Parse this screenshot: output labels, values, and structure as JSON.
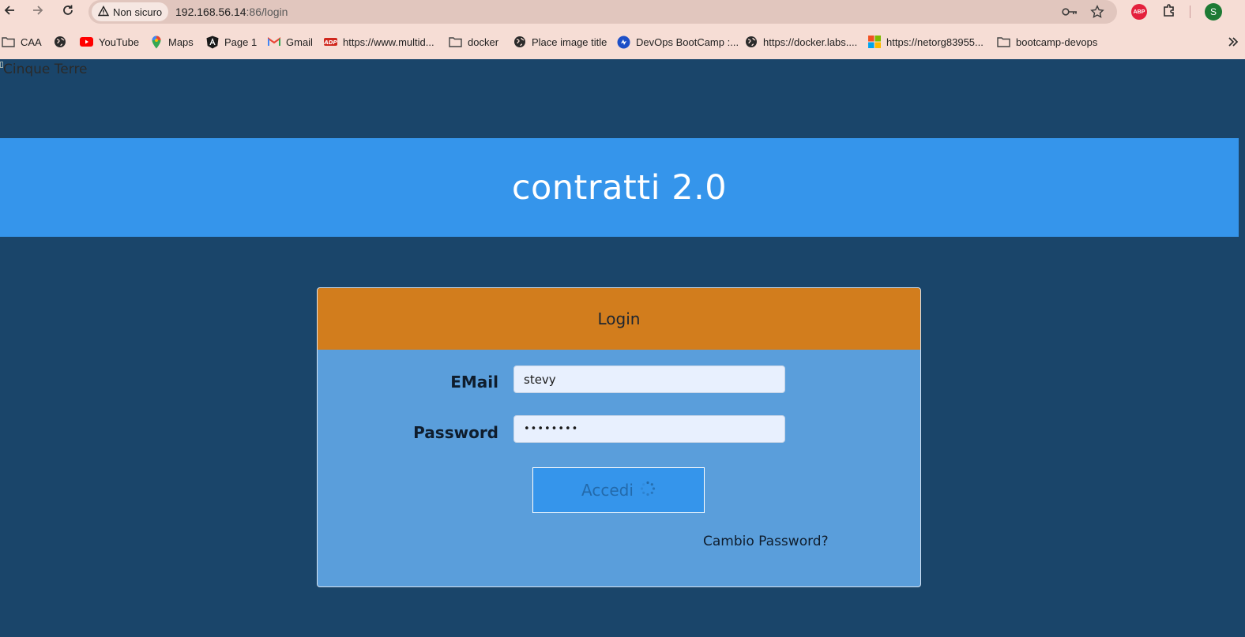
{
  "browser": {
    "security_label": "Non sicuro",
    "url_host": "192.168.56.14",
    "url_path": ":86/login",
    "avatar_letter": "S",
    "adblock_label": "ABP",
    "bookmarks": [
      {
        "label": "CAA",
        "icon": "folder-icon"
      },
      {
        "label": "",
        "icon": "globe-icon"
      },
      {
        "label": "YouTube",
        "icon": "youtube-icon"
      },
      {
        "label": "Maps",
        "icon": "maps-icon"
      },
      {
        "label": "Page 1",
        "icon": "angular-icon"
      },
      {
        "label": "Gmail",
        "icon": "gmail-icon"
      },
      {
        "label": "https://www.multid...",
        "icon": "adp-icon"
      },
      {
        "label": "docker",
        "icon": "folder-icon"
      },
      {
        "label": "Place image title",
        "icon": "globe-icon"
      },
      {
        "label": "DevOps BootCamp :...",
        "icon": "devops-icon"
      },
      {
        "label": "https://docker.labs....",
        "icon": "globe-icon"
      },
      {
        "label": "https://netorg83955...",
        "icon": "microsoft-icon"
      },
      {
        "label": "bootcamp-devops",
        "icon": "folder-icon"
      }
    ],
    "colors": {
      "chrome": "#f6ddd5",
      "omnibox": "#e1c6be"
    }
  },
  "page": {
    "broken_image_alt": "Cinque Terre",
    "banner_title": "contratti 2.0",
    "login": {
      "title": "Login",
      "email_label": "EMail",
      "email_value": "stevy",
      "password_label": "Password",
      "password_value": "••••••••",
      "submit_label": "Accedi",
      "submit_state": "loading",
      "change_password_link": "Cambio Password?"
    },
    "colors": {
      "background": "#1a456a",
      "banner": "#3595eb",
      "card": "#5a9edb",
      "card_header": "#d27d1d",
      "button": "#3595eb"
    }
  }
}
